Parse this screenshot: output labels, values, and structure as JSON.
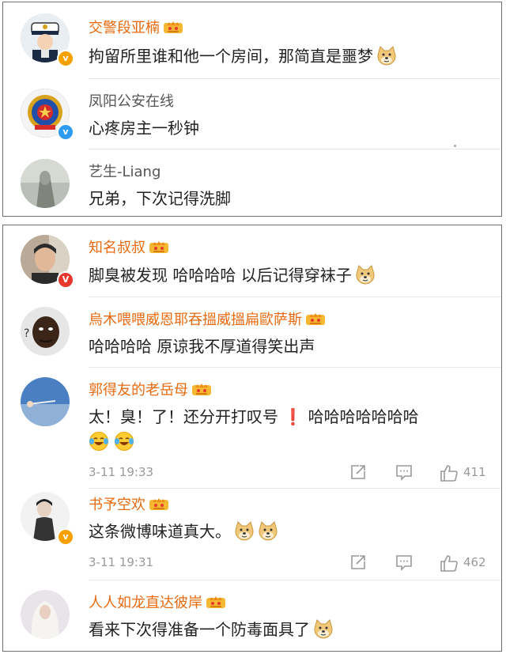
{
  "panel_top": {
    "comments": [
      {
        "name": "交警段亚楠",
        "text": "拘留所里谁和他一个房间，那简直是噩梦"
      },
      {
        "name": "凤阳公安在线",
        "text": "心疼房主一秒钟"
      },
      {
        "name": "艺生-Liang",
        "text": "兄弟，下次记得洗脚"
      }
    ]
  },
  "panel_bottom": {
    "comments": [
      {
        "name": "知名叔叔",
        "text": "脚臭被发现 哈哈哈哈 以后记得穿袜子"
      },
      {
        "name": "烏木喂喂威恩耶吞搵威搵扁歐萨斯",
        "text": "哈哈哈哈 原谅我不厚道得笑出声"
      },
      {
        "name": "郭得友的老岳母",
        "text_a": "太！臭！了！还分开打叹号",
        "excl": "❗",
        "text_b": "哈哈哈哈哈哈哈",
        "time": "3-11 19:33",
        "likes": "411"
      },
      {
        "name": "书予空欢",
        "text": "这条微博味道真大。",
        "time": "3-11 19:31",
        "likes": "462"
      },
      {
        "name": "人人如龙直达彼岸",
        "text": "看来下次得准备一个防毒面具了"
      }
    ]
  },
  "colors": {
    "vip_name": "#e86a10",
    "plain_name": "#555555",
    "verified_blue": "#2f9bf0",
    "verified_orange": "#f6a100",
    "verified_red": "#e8382d"
  },
  "icons": {
    "vip": "crown-icon",
    "doge": "doge-emoji-icon",
    "laugh": "laugh-cry-emoji-icon",
    "share": "share-icon",
    "reply": "comment-icon",
    "like": "thumbs-up-icon"
  }
}
